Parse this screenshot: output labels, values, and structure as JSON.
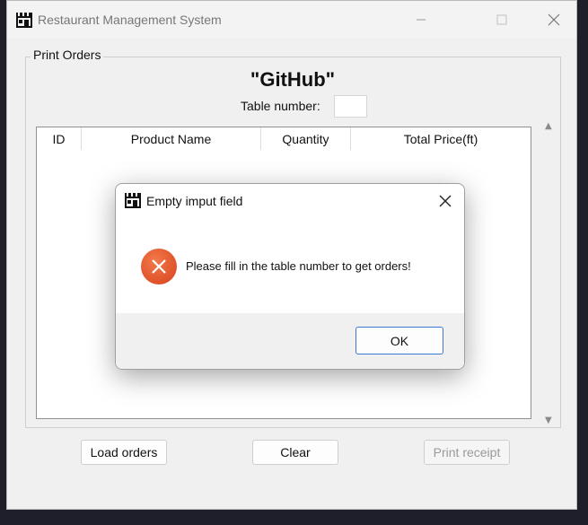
{
  "window": {
    "title": "Restaurant Management System"
  },
  "print_orders": {
    "group_label": "Print Orders",
    "heading": "\"GitHub\"",
    "table_number_label": "Table number:",
    "table_number_value": ""
  },
  "table": {
    "columns": [
      "ID",
      "Product Name",
      "Quantity",
      "Total Price(ft)"
    ],
    "rows": []
  },
  "buttons": {
    "load": "Load orders",
    "clear": "Clear",
    "print": "Print receipt"
  },
  "dialog": {
    "title": "Empty imput field",
    "message": "Please fill in the table number to get orders!",
    "ok": "OK"
  },
  "colors": {
    "error_icon": "#d7401c",
    "ok_border": "#3c78d8"
  }
}
